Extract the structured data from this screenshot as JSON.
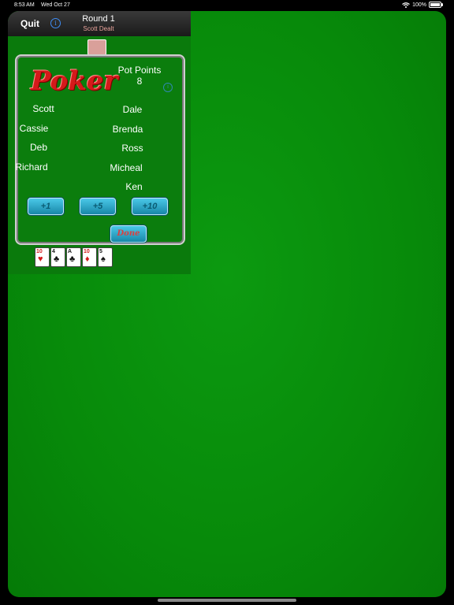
{
  "status": {
    "time": "8:53 AM",
    "date": "Wed Oct 27",
    "battery": "100%",
    "battery_level": 1.0
  },
  "nav": {
    "quit": "Quit",
    "round": "Round 1",
    "dealt": "Scott Dealt"
  },
  "dialog": {
    "title": "Poker",
    "pot_label": "Pot Points",
    "pot_value": "8",
    "players_left": [
      "Scott",
      "Cassie",
      "Deb",
      "Richard"
    ],
    "players_right": [
      "Dale",
      "Brenda",
      "Ross",
      "Micheal",
      "Ken"
    ],
    "buttons": [
      "+1",
      "+5",
      "+10"
    ],
    "done": "Done"
  },
  "hand": [
    {
      "rank": "10",
      "suit": "♥",
      "color": "red"
    },
    {
      "rank": "4",
      "suit": "♣",
      "color": "black"
    },
    {
      "rank": "A",
      "suit": "♣",
      "color": "black"
    },
    {
      "rank": "10",
      "suit": "♦",
      "color": "red"
    },
    {
      "rank": "5",
      "suit": "♠",
      "color": "black"
    }
  ],
  "colors": {
    "felt": "#078a0a",
    "logo": "#d41a1a",
    "button": "#2aa6c8",
    "dealt_text": "#e8a39b"
  },
  "icons": [
    "wifi-icon",
    "battery-icon",
    "info-icon"
  ]
}
